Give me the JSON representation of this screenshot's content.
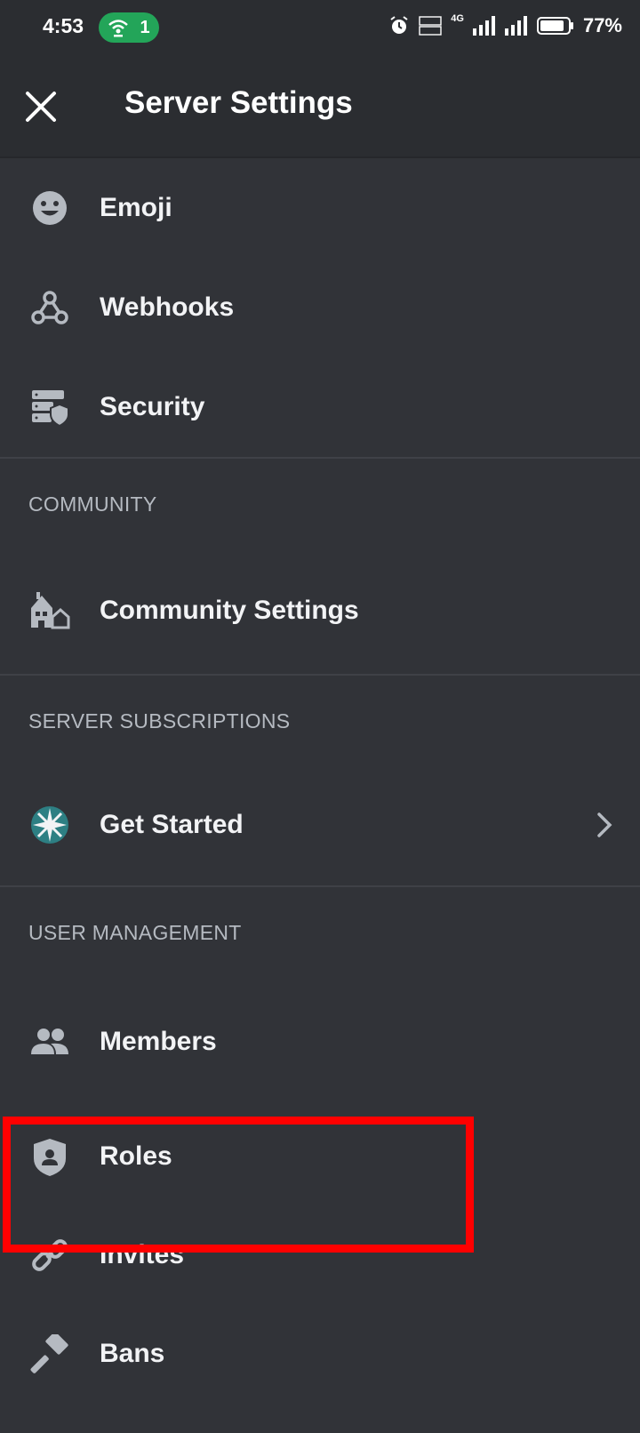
{
  "status_bar": {
    "time": "4:53",
    "hotspot_count": "1",
    "network": "4G",
    "battery": "77%"
  },
  "header": {
    "title": "Server Settings"
  },
  "items_top": [
    {
      "label": "Emoji",
      "icon": "emoji-icon"
    },
    {
      "label": "Webhooks",
      "icon": "webhooks-icon"
    },
    {
      "label": "Security",
      "icon": "security-icon"
    }
  ],
  "sections": {
    "community": {
      "heading": "COMMUNITY",
      "items": [
        {
          "label": "Community Settings",
          "icon": "community-icon"
        }
      ]
    },
    "subscriptions": {
      "heading": "SERVER SUBSCRIPTIONS",
      "items": [
        {
          "label": "Get Started",
          "icon": "subscriptions-star-icon"
        }
      ]
    },
    "user_management": {
      "heading": "USER MANAGEMENT",
      "items": [
        {
          "label": "Members",
          "icon": "members-icon"
        },
        {
          "label": "Roles",
          "icon": "roles-shield-icon"
        },
        {
          "label": "Invites",
          "icon": "link-icon"
        },
        {
          "label": "Bans",
          "icon": "hammer-icon"
        }
      ]
    }
  },
  "colors": {
    "background": "#313338",
    "header": "#2b2d31",
    "hotspot": "#23a559",
    "highlight": "#ff0000",
    "icon": "#b5bac1"
  }
}
